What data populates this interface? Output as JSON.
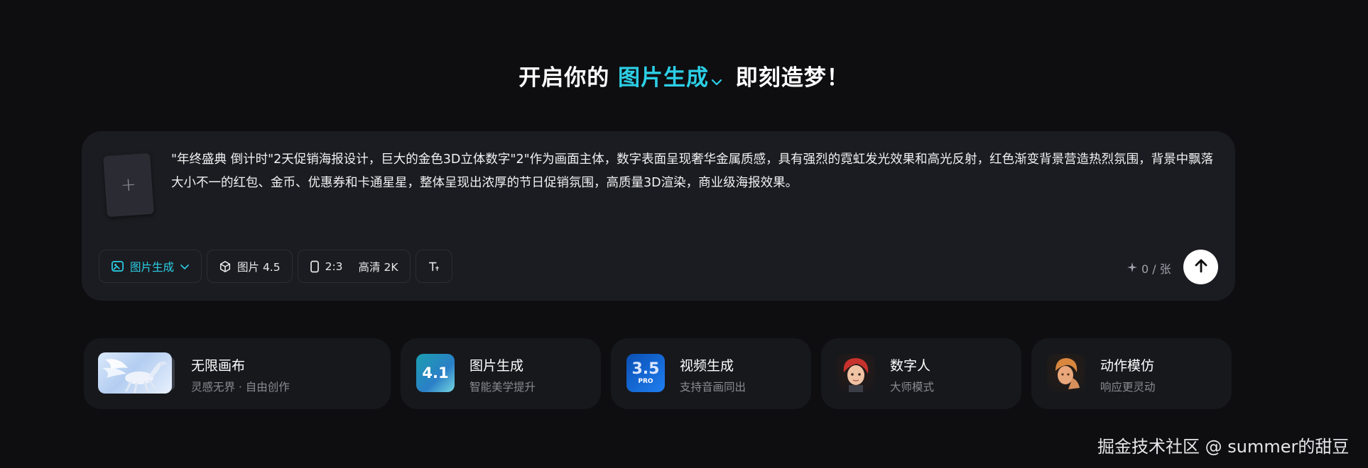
{
  "header": {
    "prefix": "开启你的",
    "mode": "图片生成",
    "suffix": "即刻造梦！"
  },
  "prompt": {
    "text": "\"年终盛典 倒计时\"2天促销海报设计，巨大的金色3D立体数字\"2\"作为画面主体，数字表面呈现奢华金属质感，具有强烈的霓虹发光效果和高光反射，红色渐变背景营造热烈氛围，背景中飘落大小不一的红包、金币、优惠券和卡通星星，整体呈现出浓厚的节日促销氛围，高质量3D渲染，商业级海报效果。",
    "upload_icon": "plus-icon"
  },
  "toolbar": {
    "mode_label": "图片生成",
    "model_label": "图片 4.5",
    "ratio_label": "2:3",
    "quality_label": "高清 2K",
    "credit_text": "0 / 张"
  },
  "features": [
    {
      "title": "无限画布",
      "subtitle": "灵感无界 · 自由创作"
    },
    {
      "title": "图片生成",
      "subtitle": "智能美学提升",
      "badge": "4.1"
    },
    {
      "title": "视频生成",
      "subtitle": "支持音画同出",
      "badge": "3.5",
      "badge_sub": "PRO"
    },
    {
      "title": "数字人",
      "subtitle": "大师模式"
    },
    {
      "title": "动作模仿",
      "subtitle": "响应更灵动"
    }
  ],
  "watermark": "掘金技术社区 @ summer的甜豆",
  "colors": {
    "accent": "#2ccfe6",
    "background": "#0e0e11",
    "card": "#1b1c21"
  }
}
